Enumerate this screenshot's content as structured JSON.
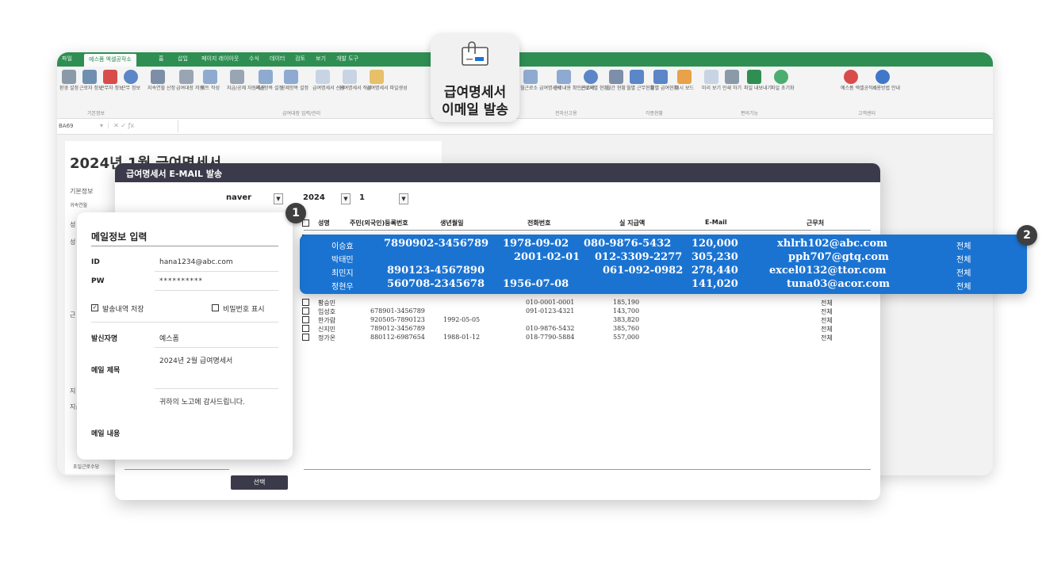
{
  "excel": {
    "tabs": [
      "파일",
      "예스폼 엑셀공작소",
      "홈",
      "삽입",
      "페이지 레이아웃",
      "수식",
      "데이터",
      "검토",
      "보기",
      "개발 도구"
    ],
    "ribbon_items": [
      "환경 설정",
      "근로자 정보",
      "근무자 정보",
      "근무 정보",
      "지속연월 산정",
      "급여대장 저장",
      "세트 작성",
      "지급/공제 자동계산",
      "지급항목 설정",
      "공제항목 설정",
      "급여명세서 선택",
      "급여명세서 작성",
      "급여명세서 파일생성",
      "월근로소 급여명세서",
      "근로내용 확인신고서",
      "근로자별 현황",
      "월간 현황",
      "월별 근무현황",
      "월별 급여현황",
      "대시 보드",
      "미리 보기",
      "인쇄 하기",
      "파일 내보내기",
      "파일 초기화",
      "예스폼 엑셀공작소",
      "사용방법 안내"
    ],
    "ribbon_groups": [
      "기본정보",
      "급여대장 입력/관리",
      "전자신고용",
      "각종현황",
      "편의기능",
      "고객센터"
    ],
    "name_box": "BA69",
    "sheet_title": "2024년 1월 급여명세서",
    "sheet_labels": [
      "기본정보",
      "귀속연월",
      "성",
      "성",
      "근",
      "지",
      "지급",
      "초일근로수당"
    ]
  },
  "callout": {
    "icon": "envelope-clip-icon",
    "line1": "급여명세서",
    "line2": "이메일 발송"
  },
  "dialog": {
    "title": "급여명세서 E-MAIL 발송",
    "domain_select": "naver",
    "year_select": "2024",
    "month_select": "1",
    "columns": [
      "성명",
      "주민(외국인)등록번호",
      "생년월일",
      "전화번호",
      "실 지급액",
      "E-Mail",
      "근무처"
    ],
    "highlighted_rows": [
      {
        "name": "이승효",
        "rrn": "7890902-3456789",
        "birth": "1978-09-02",
        "phone": "080-9876-5432",
        "pay": "120,000",
        "email": "xhlrh102@abc.com",
        "work": "전체",
        "checked": true
      },
      {
        "name": "박태민",
        "rrn": "",
        "birth": "2001-02-01",
        "phone": "012-3309-2277",
        "pay": "305,230",
        "email": "pph707@gtq.com",
        "work": "전체",
        "checked": true
      },
      {
        "name": "최민지",
        "rrn": "890123-4567890",
        "birth": "",
        "phone": "061-092-0982",
        "pay": "278,440",
        "email": "excel0132@ttor.com",
        "work": "전체",
        "checked": true
      },
      {
        "name": "정현우",
        "rrn": "560708-2345678",
        "birth": "1956-07-08",
        "phone": "",
        "pay": "141,020",
        "email": "tuna03@acor.com",
        "work": "전체",
        "checked": true
      }
    ],
    "rows": [
      {
        "name": "황승민",
        "rrn": "",
        "birth": "",
        "phone": "010-0001-0001",
        "pay": "185,190",
        "work": "전체"
      },
      {
        "name": "임성호",
        "rrn": "678901-3456789",
        "birth": "",
        "phone": "091-0123-4321",
        "pay": "143,700",
        "work": "전체"
      },
      {
        "name": "한가람",
        "rrn": "920505-7890123",
        "birth": "1992-05-05",
        "phone": "",
        "pay": "383,820",
        "work": "전체"
      },
      {
        "name": "신지민",
        "rrn": "789012-3456789",
        "birth": "",
        "phone": "010-9876-5432",
        "pay": "385,760",
        "work": "전체"
      },
      {
        "name": "정가온",
        "rrn": "880112-6987654",
        "birth": "1988-01-12",
        "phone": "018-7790-5884",
        "pay": "557,000",
        "work": "전체"
      }
    ],
    "select_button": "선택"
  },
  "panel": {
    "title": "메일정보 입력",
    "id_label": "ID",
    "id_value": "hana1234@abc.com",
    "pw_label": "PW",
    "pw_value": "**********",
    "save_label": "발송내역 저장",
    "show_pw_label": "비밀번호 표시",
    "sender_label": "발신자명",
    "sender_value": "예스폼",
    "subject_label": "메일 제목",
    "subject_value": "2024년 2월 급여명세서",
    "body_label": "메일 내용",
    "body_value": "귀하의 노고에 감사드립니다."
  },
  "badges": [
    "1",
    "2"
  ],
  "colors": {
    "excel_green": "#2f8f53",
    "highlight_blue": "#1b73d1",
    "dialog_dark": "#3a3a4a"
  }
}
